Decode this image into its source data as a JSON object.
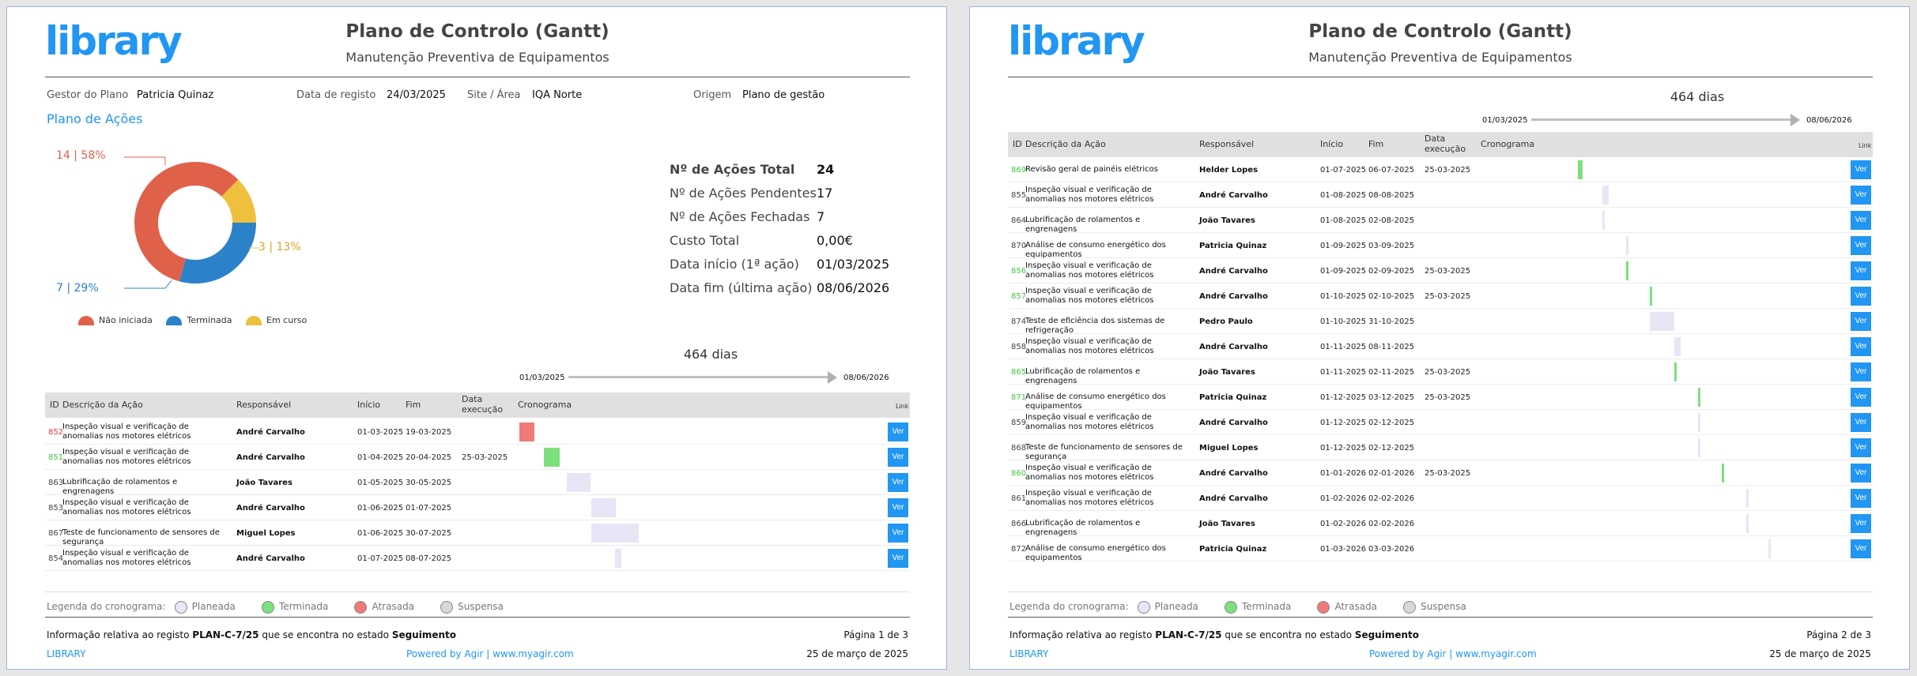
{
  "logo": "library",
  "title": "Plano de Controlo (Gantt)",
  "subtitle": "Manutenção Preventiva de Equipamentos",
  "meta": {
    "gestor_label": "Gestor do Plano",
    "gestor": "Patricia Quinaz",
    "data_label": "Data de registo",
    "data": "24/03/2025",
    "site_label": "Site / Área",
    "site": "IQA Norte",
    "origem_label": "Origem",
    "origem": "Plano de gestão"
  },
  "section": "Plano de Ações",
  "donut": {
    "slices": [
      {
        "label": "14 | 58%",
        "value": 14,
        "color": "#e0614a"
      },
      {
        "label": "7 | 29%",
        "value": 7,
        "color": "#2b82c9"
      },
      {
        "label": "3 | 13%",
        "value": 3,
        "color": "#efbf3e"
      }
    ],
    "legend": [
      "Não iniciada",
      "Terminada",
      "Em curso"
    ],
    "legend_colors": [
      "#e0614a",
      "#2b82c9",
      "#efbf3e"
    ]
  },
  "stats": [
    {
      "label": "Nº de Ações Total",
      "value": "24"
    },
    {
      "label": "Nº de Ações Pendentes",
      "value": "17"
    },
    {
      "label": "Nº de Ações Fechadas",
      "value": "7"
    },
    {
      "label": "Custo Total",
      "value": "0,00€"
    },
    {
      "label": "Data início (1ª ação)",
      "value": "01/03/2025"
    },
    {
      "label": "Data fim (última ação)",
      "value": "08/06/2026"
    }
  ],
  "timeline": {
    "days": "464 dias",
    "start": "01/03/2025",
    "end": "08/06/2026"
  },
  "headers": {
    "id": "ID",
    "desc": "Descrição da Ação",
    "resp": "Responsável",
    "ini": "Início",
    "fim": "Fim",
    "exec1": "Data",
    "exec2": "execução",
    "cron": "Cronograma",
    "link": "Link"
  },
  "ver": "Ver",
  "colors": {
    "planned": "#e6e6f7",
    "done": "#7de07d",
    "late": "#f07a7a",
    "id_late": "#e53935",
    "id_done": "#43c843"
  },
  "rows1": [
    {
      "id": "852",
      "desc": "Inspeção visual e verificação de anomalias nos motores elétricos",
      "resp": "André Carvalho",
      "ini": "01-03-2025",
      "fim": "19-03-2025",
      "exec": "",
      "status": "late",
      "start": 0,
      "end": 18
    },
    {
      "id": "851",
      "desc": "Inspeção visual e verificação de anomalias nos motores elétricos",
      "resp": "André Carvalho",
      "ini": "01-04-2025",
      "fim": "20-04-2025",
      "exec": "25-03-2025",
      "status": "done",
      "start": 31,
      "end": 50
    },
    {
      "id": "863",
      "desc": "Lubrificação de rolamentos e engrenagens",
      "resp": "João Tavares",
      "ini": "01-05-2025",
      "fim": "30-05-2025",
      "exec": "",
      "status": "planned",
      "start": 61,
      "end": 90
    },
    {
      "id": "853",
      "desc": "Inspeção visual e verificação de anomalias nos motores elétricos",
      "resp": "André Carvalho",
      "ini": "01-06-2025",
      "fim": "01-07-2025",
      "exec": "",
      "status": "planned",
      "start": 92,
      "end": 122
    },
    {
      "id": "867",
      "desc": "Teste de funcionamento de sensores de segurança",
      "resp": "Miguel Lopes",
      "ini": "01-06-2025",
      "fim": "30-07-2025",
      "exec": "",
      "status": "planned",
      "start": 92,
      "end": 151
    },
    {
      "id": "854",
      "desc": "Inspeção visual e verificação de anomalias nos motores elétricos",
      "resp": "André Carvalho",
      "ini": "01-07-2025",
      "fim": "08-07-2025",
      "exec": "",
      "status": "planned",
      "start": 122,
      "end": 129
    }
  ],
  "rows2": [
    {
      "id": "869",
      "desc": "Revisão geral de painéis elétricos",
      "resp": "Helder Lopes",
      "ini": "01-07-2025",
      "fim": "06-07-2025",
      "exec": "25-03-2025",
      "status": "done",
      "start": 122,
      "end": 127
    },
    {
      "id": "855",
      "desc": "Inspeção visual e verificação de anomalias nos motores elétricos",
      "resp": "André Carvalho",
      "ini": "01-08-2025",
      "fim": "08-08-2025",
      "exec": "",
      "status": "planned",
      "start": 153,
      "end": 160
    },
    {
      "id": "864",
      "desc": "Lubrificação de rolamentos e engrenagens",
      "resp": "João Tavares",
      "ini": "01-08-2025",
      "fim": "02-08-2025",
      "exec": "",
      "status": "planned",
      "start": 153,
      "end": 154
    },
    {
      "id": "870",
      "desc": "Análise de consumo energético dos equipamentos",
      "resp": "Patricia Quinaz",
      "ini": "01-09-2025",
      "fim": "03-09-2025",
      "exec": "",
      "status": "planned",
      "start": 184,
      "end": 186
    },
    {
      "id": "856",
      "desc": "Inspeção visual e verificação de anomalias nos motores elétricos",
      "resp": "André Carvalho",
      "ini": "01-09-2025",
      "fim": "02-09-2025",
      "exec": "25-03-2025",
      "status": "done",
      "start": 184,
      "end": 185
    },
    {
      "id": "857",
      "desc": "Inspeção visual e verificação de anomalias nos motores elétricos",
      "resp": "André Carvalho",
      "ini": "01-10-2025",
      "fim": "02-10-2025",
      "exec": "25-03-2025",
      "status": "done",
      "start": 214,
      "end": 215
    },
    {
      "id": "874",
      "desc": "Teste de eficiência dos sistemas de refrigeração",
      "resp": "Pedro Paulo",
      "ini": "01-10-2025",
      "fim": "31-10-2025",
      "exec": "",
      "status": "planned",
      "start": 214,
      "end": 244
    },
    {
      "id": "858",
      "desc": "Inspeção visual e verificação de anomalias nos motores elétricos",
      "resp": "André Carvalho",
      "ini": "01-11-2025",
      "fim": "08-11-2025",
      "exec": "",
      "status": "planned",
      "start": 245,
      "end": 252
    },
    {
      "id": "865",
      "desc": "Lubrificação de rolamentos e engrenagens",
      "resp": "João Tavares",
      "ini": "01-11-2025",
      "fim": "02-11-2025",
      "exec": "25-03-2025",
      "status": "done",
      "start": 245,
      "end": 246
    },
    {
      "id": "871",
      "desc": "Análise de consumo energético dos equipamentos",
      "resp": "Patricia Quinaz",
      "ini": "01-12-2025",
      "fim": "03-12-2025",
      "exec": "25-03-2025",
      "status": "done",
      "start": 275,
      "end": 277
    },
    {
      "id": "859",
      "desc": "Inspeção visual e verificação de anomalias nos motores elétricos",
      "resp": "André Carvalho",
      "ini": "01-12-2025",
      "fim": "02-12-2025",
      "exec": "",
      "status": "planned",
      "start": 275,
      "end": 276
    },
    {
      "id": "868",
      "desc": "Teste de funcionamento de sensores de segurança",
      "resp": "Miguel Lopes",
      "ini": "01-12-2025",
      "fim": "02-12-2025",
      "exec": "",
      "status": "planned",
      "start": 275,
      "end": 276
    },
    {
      "id": "860",
      "desc": "Inspeção visual e verificação de anomalias nos motores elétricos",
      "resp": "André Carvalho",
      "ini": "01-01-2026",
      "fim": "02-01-2026",
      "exec": "25-03-2025",
      "status": "done",
      "start": 306,
      "end": 307
    },
    {
      "id": "861",
      "desc": "Inspeção visual e verificação de anomalias nos motores elétricos",
      "resp": "André Carvalho",
      "ini": "01-02-2026",
      "fim": "02-02-2026",
      "exec": "",
      "status": "planned",
      "start": 337,
      "end": 338
    },
    {
      "id": "866",
      "desc": "Lubrificação de rolamentos e engrenagens",
      "resp": "João Tavares",
      "ini": "01-02-2026",
      "fim": "02-02-2026",
      "exec": "",
      "status": "planned",
      "start": 337,
      "end": 338
    },
    {
      "id": "872",
      "desc": "Análise de consumo energético dos equipamentos",
      "resp": "Patricia Quinaz",
      "ini": "01-03-2026",
      "fim": "03-03-2026",
      "exec": "",
      "status": "planned",
      "start": 365,
      "end": 367
    }
  ],
  "legend": {
    "title": "Legenda do cronograma:",
    "items": [
      {
        "label": "Planeada",
        "color": "#e6e6f7"
      },
      {
        "label": "Terminada",
        "color": "#7de07d"
      },
      {
        "label": "Atrasada",
        "color": "#f07a7a"
      },
      {
        "label": "Suspensa",
        "color": "#d8d8d8"
      }
    ]
  },
  "footer": {
    "pre": "Informação relativa ao registo",
    "reg": "PLAN-C-7/25",
    "mid": "que se encontra no estado",
    "state": "Seguimento",
    "page1": "Página 1 de 3",
    "page2": "Página 2 de 3",
    "brand": "LIBRARY",
    "powered": "Powered by Agir | www.myagir.com",
    "date": "25 de março de 2025"
  }
}
